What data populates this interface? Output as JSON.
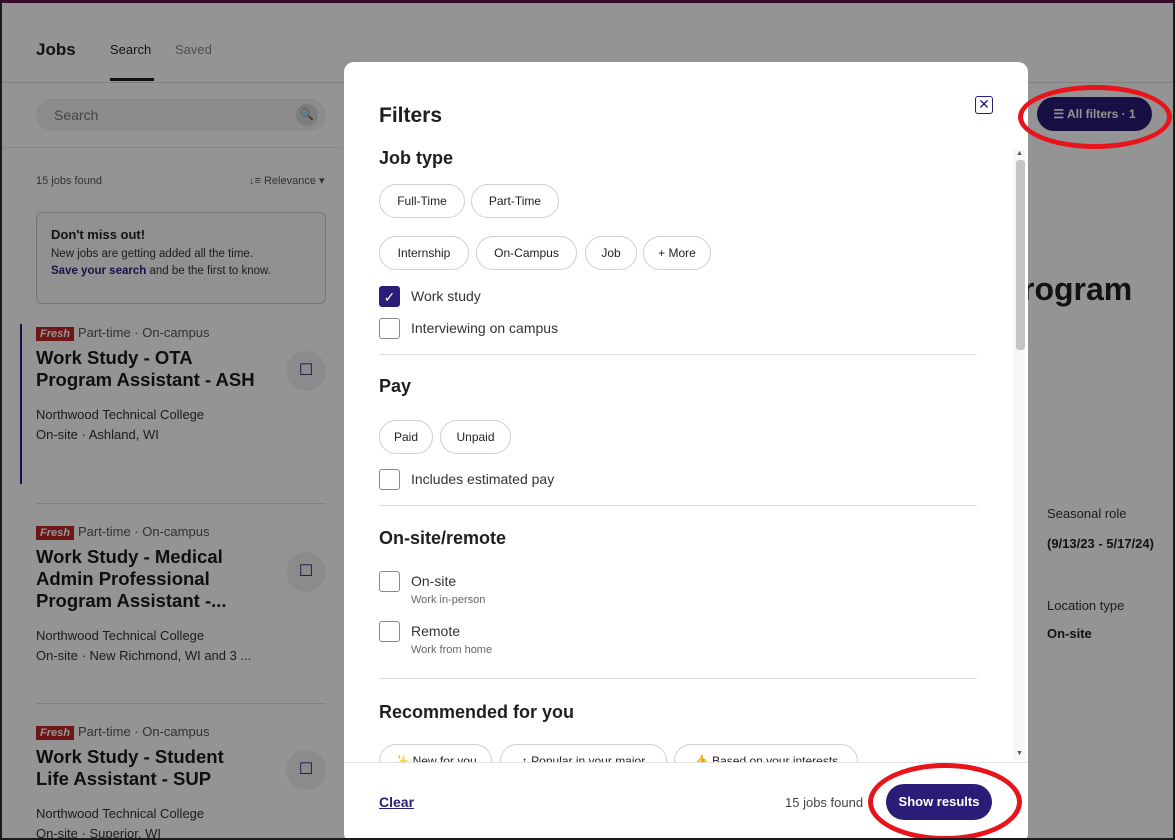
{
  "header": {
    "brand": "Jobs",
    "tabs": [
      "Search",
      "Saved"
    ],
    "search_placeholder": "Search",
    "all_filters": "All filters · 1"
  },
  "results": {
    "count": "15 jobs found",
    "sort": "Relevance"
  },
  "promo": {
    "title": "Don't miss out!",
    "line1": "New jobs are getting added all the time.",
    "link": "Save your search",
    "line2": " and be the first to know."
  },
  "jobs": [
    {
      "badge": "Fresh",
      "meta": "Part-time · On-campus",
      "title": "Work Study - OTA Program Assistant - ASH",
      "company": "Northwood Technical College",
      "location": "On-site · Ashland, WI"
    },
    {
      "badge": "Fresh",
      "meta": "Part-time · On-campus",
      "title": "Work Study - Medical Admin Professional Program Assistant -...",
      "company": "Northwood Technical College",
      "location": "On-site · New Richmond, WI and 3 ..."
    },
    {
      "badge": "Fresh",
      "meta": "Part-time · On-campus",
      "title": "Work Study - Student Life Assistant - SUP",
      "company": "Northwood Technical College",
      "location": "On-site · Superior, WI"
    }
  ],
  "detail": {
    "heading": "rogram",
    "seasonal_label": "Seasonal role",
    "seasonal_value": "(9/13/23 - 5/17/24)",
    "loc_label": "Location type",
    "loc_value": "On-site"
  },
  "modal": {
    "title": "Filters",
    "job_type": {
      "title": "Job type",
      "chips": [
        "Full-Time",
        "Part-Time",
        "Internship",
        "On-Campus",
        "Job",
        "+ More"
      ],
      "work_study": "Work study",
      "interviewing": "Interviewing on campus"
    },
    "pay": {
      "title": "Pay",
      "chips": [
        "Paid",
        "Unpaid"
      ],
      "estimated": "Includes estimated pay"
    },
    "onsite": {
      "title": "On-site/remote",
      "onsite": "On-site",
      "onsite_sub": "Work in-person",
      "remote": "Remote",
      "remote_sub": "Work from home"
    },
    "recommended": {
      "title": "Recommended for you",
      "chips": [
        "New for you",
        "Popular in your major",
        "Based on your interests"
      ]
    },
    "footer": {
      "clear": "Clear",
      "found": "15 jobs found",
      "show": "Show results"
    }
  }
}
